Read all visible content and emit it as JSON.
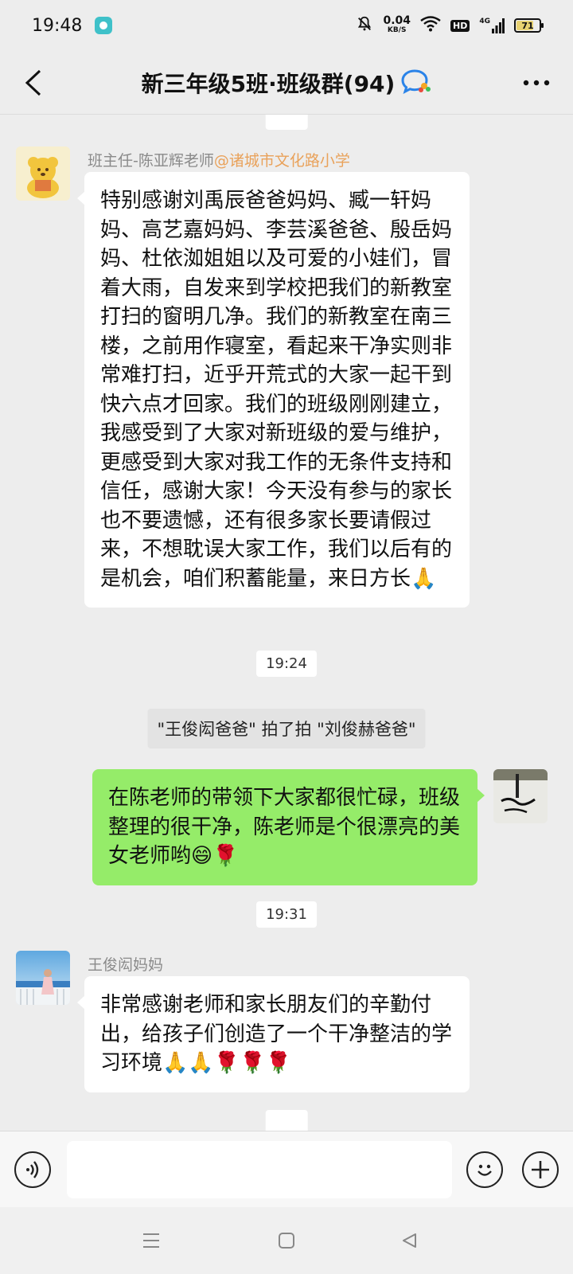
{
  "status_bar": {
    "time": "19:48",
    "net_speed_value": "0.04",
    "net_speed_unit": "KB/S",
    "hd_label": "HD",
    "signal_label": "4G",
    "battery_level": "71"
  },
  "header": {
    "title": "新三年级5班·班级群(94)"
  },
  "chat": {
    "timestamps": [
      "19:24",
      "19:31"
    ],
    "messages": [
      {
        "sender_name": "班主任-陈亚辉老师",
        "sender_org": "@诸城市文化路小学",
        "text": "特别感谢刘禹辰爸爸妈妈、臧一轩妈妈、高艺嘉妈妈、李芸溪爸爸、殷岳妈妈、杜依洳姐姐以及可爱的小娃们，冒着大雨，自发来到学校把我们的新教室打扫的窗明几净。我们的新教室在南三楼，之前用作寝室，看起来干净实则非常难打扫，近乎开荒式的大家一起干到快六点才回家。我们的班级刚刚建立，我感受到了大家对新班级的爱与维护，更感受到大家对我工作的无条件支持和信任，感谢大家！今天没有参与的家长也不要遗憾，还有很多家长要请假过来，不想耽误大家工作，我们以后有的是机会，咱们积蓄能量，来日方长🙏"
      },
      {
        "text": "在陈老师的带领下大家都很忙碌，班级整理的很干净，陈老师是个很漂亮的美女老师哟😄🌹"
      },
      {
        "sender_name": "王俊闳妈妈",
        "text": "非常感谢老师和家长朋友们的辛勤付出，给孩子们创造了一个干净整洁的学习环境🙏🙏🌹🌹🌹"
      }
    ],
    "system_notice": "\"王俊闳爸爸\" 拍了拍 \"刘俊赫爸爸\""
  },
  "input": {
    "placeholder": ""
  },
  "colors": {
    "my_bubble": "#95ec69",
    "org_tag": "#e9a25b",
    "background": "#ededed"
  }
}
